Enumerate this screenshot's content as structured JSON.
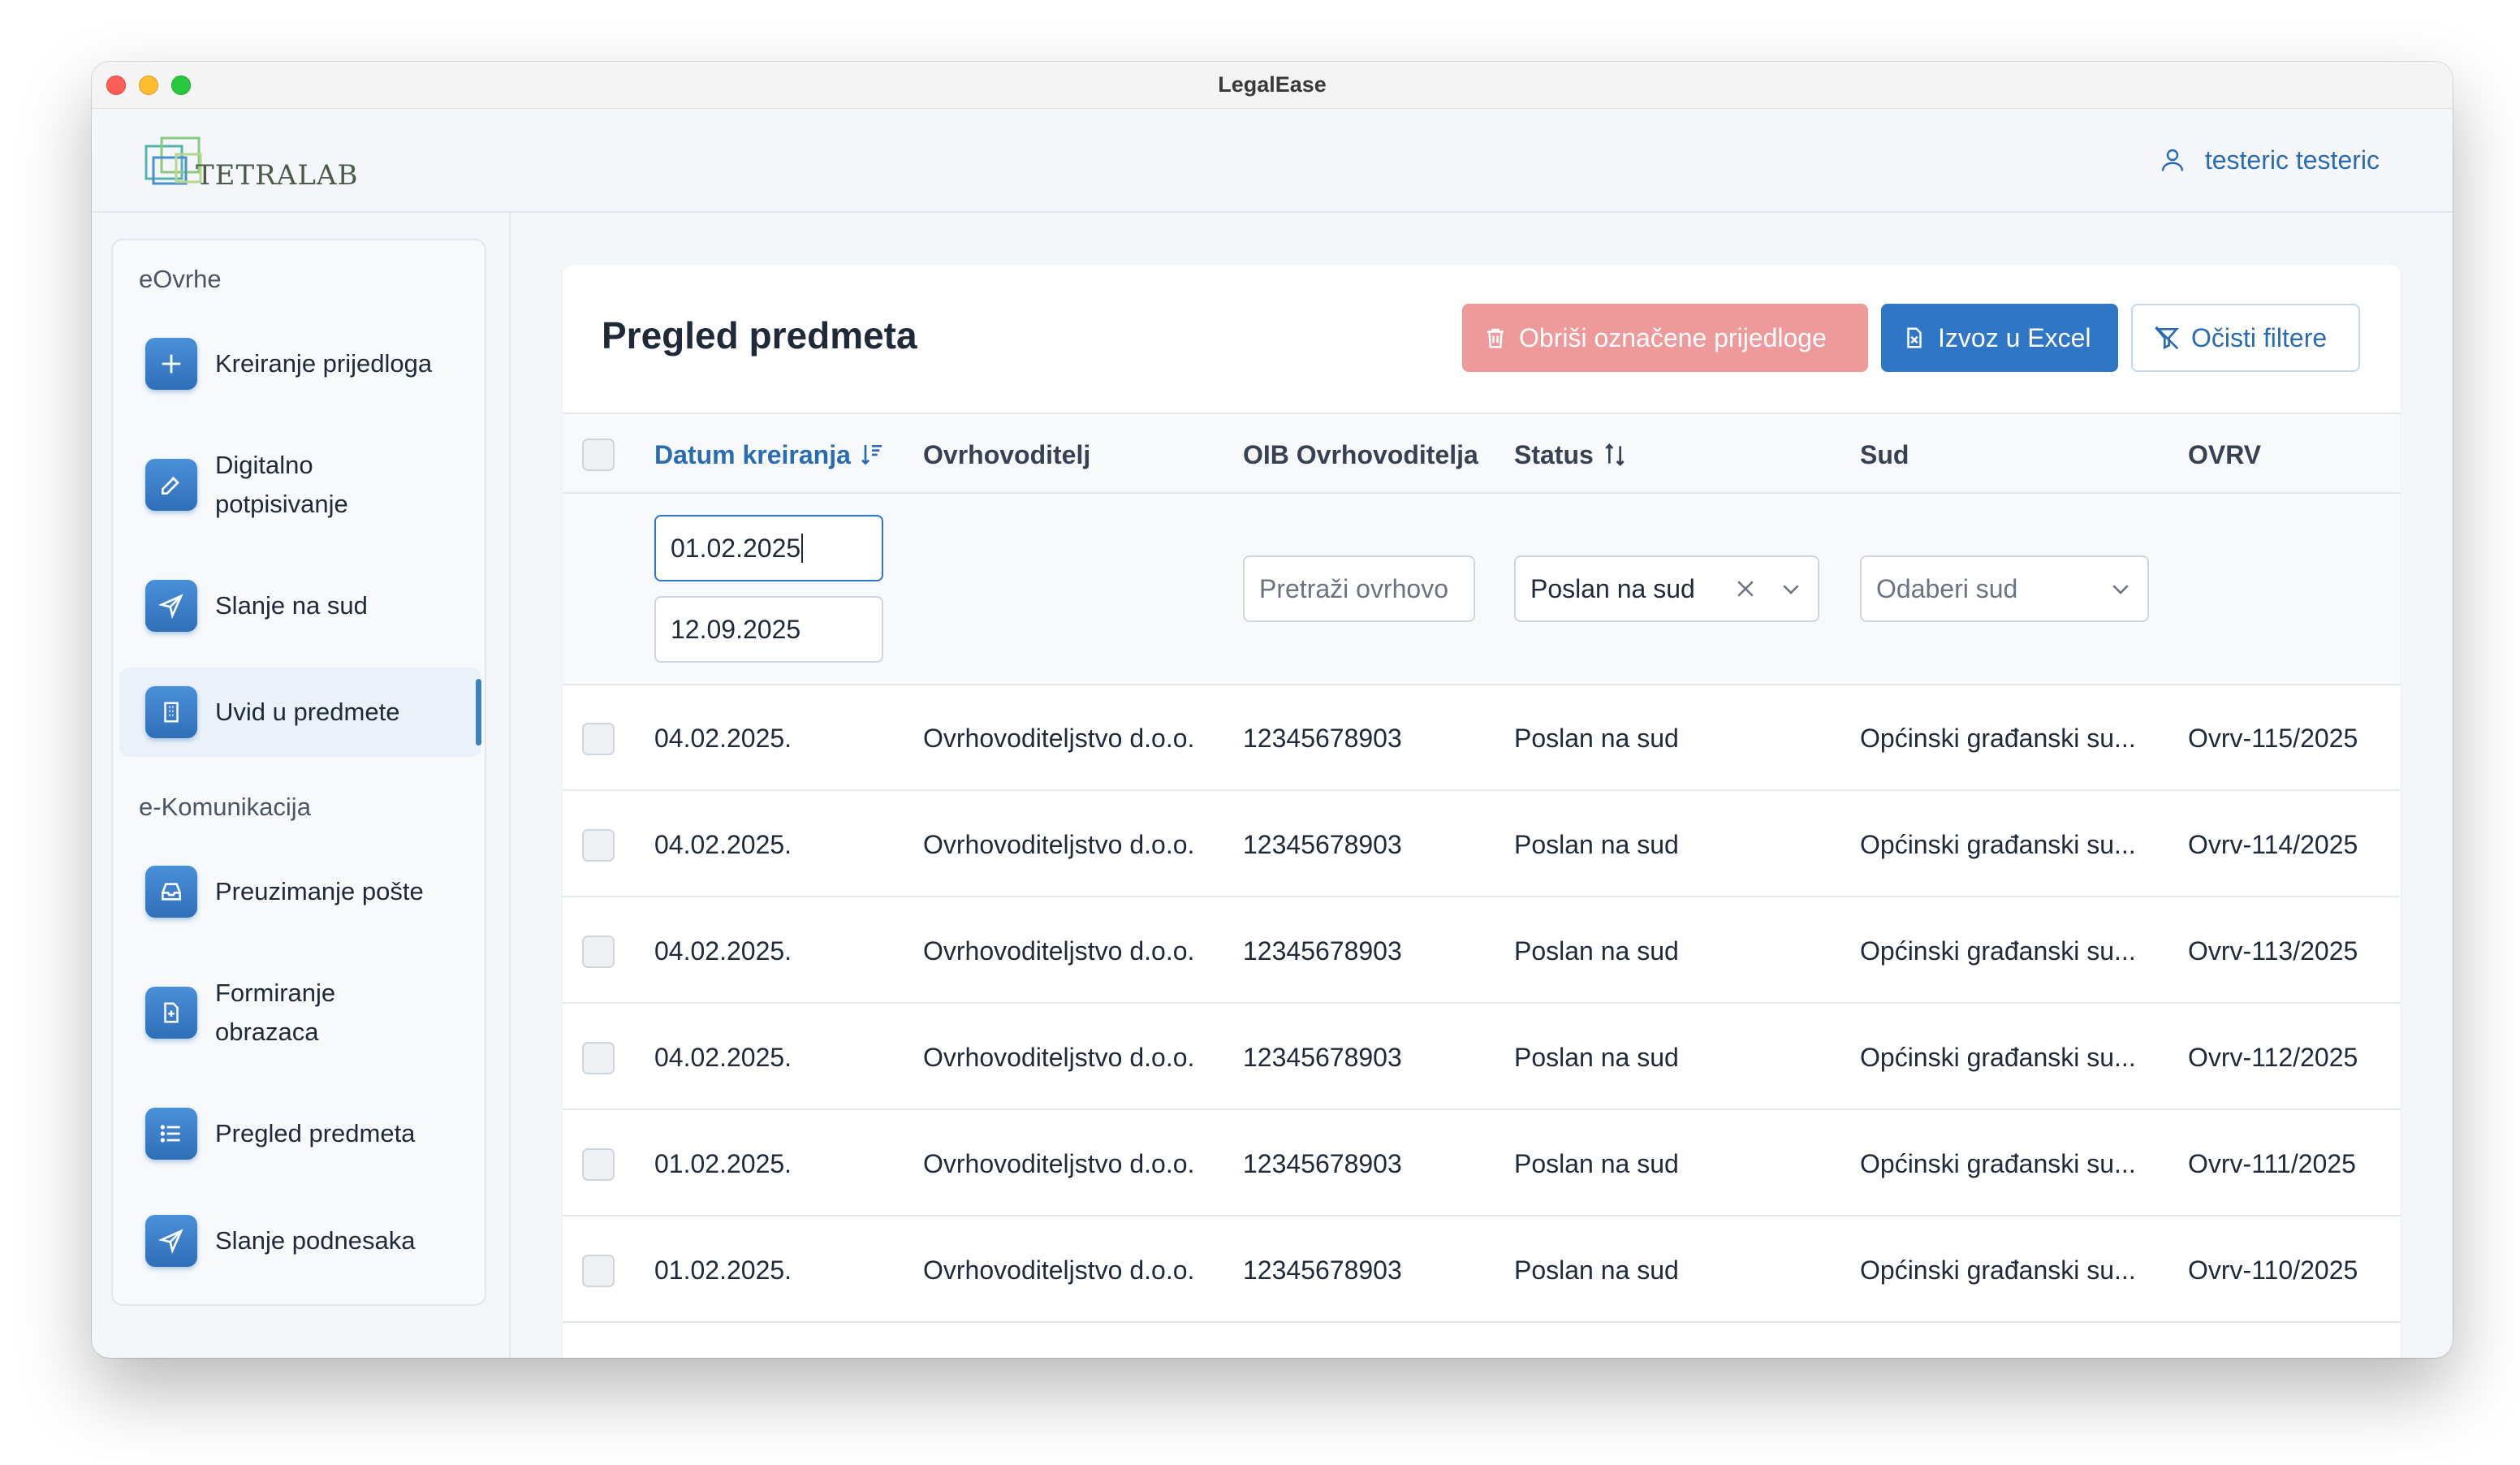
{
  "window": {
    "title": "LegalEase"
  },
  "header": {
    "logo_text": "TETRALAB",
    "user_name": "testeric testeric"
  },
  "sidebar": {
    "sections": [
      {
        "label": "eOvrhe"
      },
      {
        "label": "e-Komunikacija"
      }
    ],
    "items": [
      {
        "label": "Kreiranje prijedloga",
        "icon": "plus-icon"
      },
      {
        "label_line1": "Digitalno",
        "label_line2": "potpisivanje",
        "icon": "edit-icon"
      },
      {
        "label": "Slanje na sud",
        "icon": "send-icon"
      },
      {
        "label": "Uvid u predmete",
        "icon": "building-icon",
        "active": true
      },
      {
        "label": "Preuzimanje pošte",
        "icon": "inbox-icon"
      },
      {
        "label_line1": "Formiranje",
        "label_line2": "obrazaca",
        "icon": "file-plus-icon"
      },
      {
        "label": "Pregled predmeta",
        "icon": "list-icon"
      },
      {
        "label": "Slanje podnesaka",
        "icon": "send-icon"
      }
    ]
  },
  "main": {
    "title": "Pregled predmeta",
    "buttons": {
      "delete": "Obriši označene prijedloge",
      "export": "Izvoz u Excel",
      "clear": "Očisti filtere"
    },
    "columns": [
      "Datum kreiranja",
      "Ovrhovoditelj",
      "OIB Ovrhovoditelja",
      "Status",
      "Sud",
      "OVRV"
    ],
    "filters": {
      "date_from": "01.02.2025",
      "date_to": "12.09.2025",
      "oib_placeholder": "Pretraži ovrhovo",
      "status_value": "Poslan na sud",
      "court_placeholder": "Odaberi sud"
    },
    "rows": [
      {
        "date": "04.02.2025.",
        "creditor": "Ovrhovoditeljstvo d.o.o.",
        "oib": "12345678903",
        "status": "Poslan na sud",
        "court": "Općinski građanski su...",
        "ovrv": "Ovrv-115/2025"
      },
      {
        "date": "04.02.2025.",
        "creditor": "Ovrhovoditeljstvo d.o.o.",
        "oib": "12345678903",
        "status": "Poslan na sud",
        "court": "Općinski građanski su...",
        "ovrv": "Ovrv-114/2025"
      },
      {
        "date": "04.02.2025.",
        "creditor": "Ovrhovoditeljstvo d.o.o.",
        "oib": "12345678903",
        "status": "Poslan na sud",
        "court": "Općinski građanski su...",
        "ovrv": "Ovrv-113/2025"
      },
      {
        "date": "04.02.2025.",
        "creditor": "Ovrhovoditeljstvo d.o.o.",
        "oib": "12345678903",
        "status": "Poslan na sud",
        "court": "Općinski građanski su...",
        "ovrv": "Ovrv-112/2025"
      },
      {
        "date": "01.02.2025.",
        "creditor": "Ovrhovoditeljstvo d.o.o.",
        "oib": "12345678903",
        "status": "Poslan na sud",
        "court": "Općinski građanski su...",
        "ovrv": "Ovrv-111/2025"
      },
      {
        "date": "01.02.2025.",
        "creditor": "Ovrhovoditeljstvo d.o.o.",
        "oib": "12345678903",
        "status": "Poslan na sud",
        "court": "Općinski građanski su...",
        "ovrv": "Ovrv-110/2025"
      }
    ]
  },
  "colors": {
    "accent": "#2f77c6",
    "danger": "#ef9a9a",
    "link": "#2b6cb0"
  }
}
